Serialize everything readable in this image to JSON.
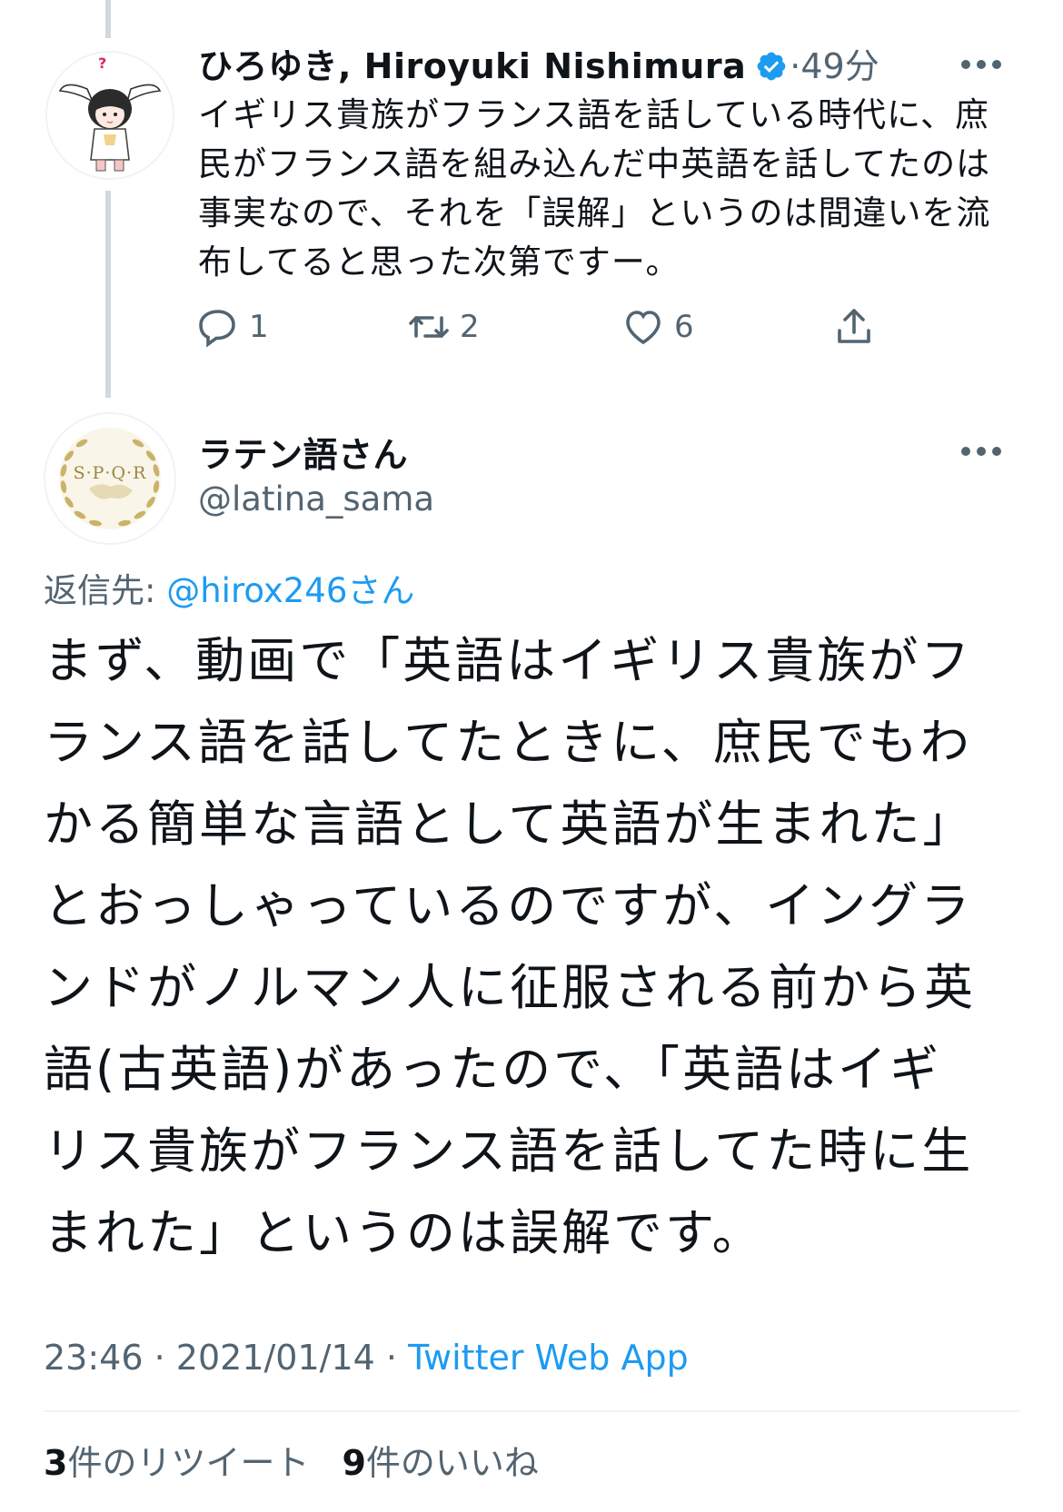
{
  "parent_tweet": {
    "display_name": "ひろゆき, Hiroyuki Nishimura",
    "dot": "·",
    "time_ago": "49分",
    "text": "イギリス貴族がフランス語を話している時代に、庶\n民がフランス語を組み込んだ中英語を話してたのは\n事実なので、それを「誤解」というのは間違いを流\n布してると思った次第ですー。",
    "reply_count": "1",
    "retweet_count": "2",
    "like_count": "6",
    "verified": true,
    "avatar_question_mark": "?"
  },
  "main_tweet": {
    "display_name": "ラテン語さん",
    "handle": "@latina_sama",
    "avatar_text": "S·P·Q·R",
    "replying_prefix": "返信先:",
    "replying_to": "@hirox246さん",
    "text": "まず、動画で「英語はイギリス貴族がフ\nランス語を話してたときに、庶民でもわ\nかる簡単な言語として英語が生まれた」\nとおっしゃっているのですが、イングラ\nンドがノルマン人に征服される前から英\n語(古英語)があったので、「英語はイギ\nリス貴族がフランス語を話してた時に生\nまれた」というのは誤解です。",
    "time": "23:46",
    "date": "2021/01/14",
    "sep": "·",
    "source_app": "Twitter Web App"
  },
  "stats": {
    "retweets_count": "3",
    "retweets_label": "件のリツイート",
    "likes_count": "9",
    "likes_label": "件のいいね"
  },
  "colors": {
    "accent": "#1d9bf0",
    "secondary_text": "#536471",
    "primary_text": "#0f1419",
    "divider": "#eff3f4",
    "thread_line": "#cfd9de",
    "laurel_gold": "#c9b26a"
  },
  "icons": [
    "verified-badge-icon",
    "more-options-icon",
    "reply-icon",
    "retweet-icon",
    "like-icon",
    "share-icon"
  ]
}
